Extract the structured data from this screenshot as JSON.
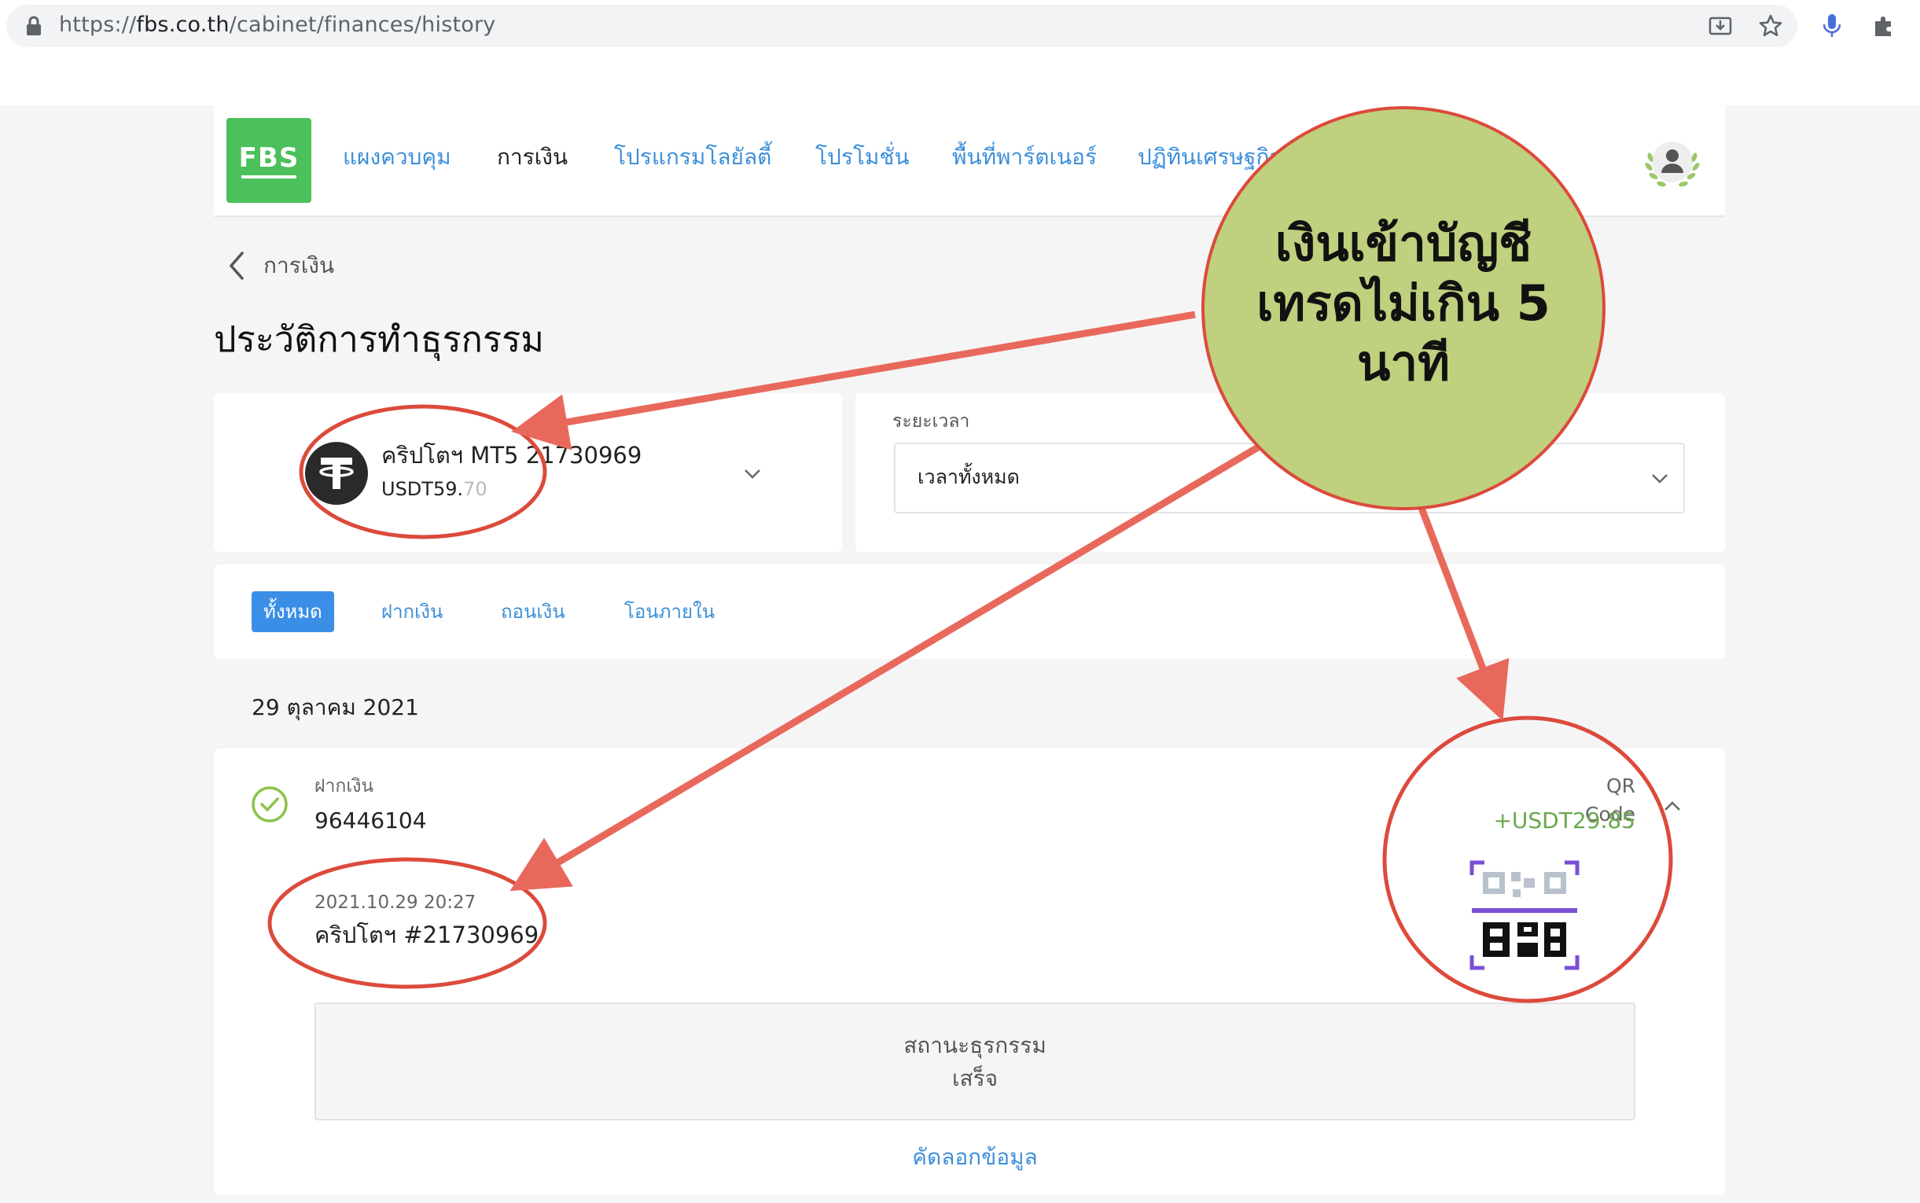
{
  "browser": {
    "url_prefix": "https://",
    "url_domain": "fbs.co.th",
    "url_path": "/cabinet/finances/history",
    "icons": [
      "lock-icon",
      "install-app-icon",
      "bookmark-star-icon",
      "microphone-icon",
      "extensions-icon"
    ]
  },
  "header": {
    "logo_text": "FBS",
    "nav": [
      {
        "label": "แผงควบคุม",
        "active": false
      },
      {
        "label": "การเงิน",
        "active": true
      },
      {
        "label": "โปรแกรมโลยัลตี้",
        "active": false
      },
      {
        "label": "โปรโมชั่น",
        "active": false
      },
      {
        "label": "พื้นที่พาร์ตเนอร์",
        "active": false
      },
      {
        "label": "ปฏิทินเศรษฐกิจ",
        "active": false
      }
    ],
    "avatar_icon": "user-avatar-laurel-icon"
  },
  "breadcrumb": {
    "label": "การเงิน"
  },
  "page_title": "ประวัติการทำธุรกรรม",
  "account": {
    "name": "คริปโตฯ  MT5  21730969",
    "balance_main": "USDT59.",
    "balance_decimal": "70",
    "icon": "tether-icon"
  },
  "period": {
    "label": "ระยะเวลา",
    "value": "เวลาทั้งหมด"
  },
  "tabs": [
    {
      "label": "ทั้งหมด",
      "active": true
    },
    {
      "label": "ฝากเงิน",
      "active": false
    },
    {
      "label": "ถอนเงิน",
      "active": false
    },
    {
      "label": "โอนภายใน",
      "active": false
    }
  ],
  "date_heading": "29 ตุลาคม 2021",
  "transaction": {
    "type": "ฝากเงิน",
    "id": "96446104",
    "datetime": "2021.10.29 20:27",
    "account": "คริปโตฯ  #21730969",
    "method": "QR Code",
    "amount": "+USDT29.85",
    "status_label": "สถานะธุรกรรม",
    "status_value": "เสร็จ",
    "copy_label": "คัดลอกข้อมูล",
    "status_icon": "check-circle-icon"
  },
  "annotation": {
    "callout_text": "เงินเข้าบัญชี\nเทรดไม่เกิน 5\nนาที",
    "callout_fill": "#bfd07e",
    "stroke_color": "#dc4a3c",
    "arrow_color": "#e8695c"
  },
  "colors": {
    "brand_green": "#4cc05a",
    "link_blue": "#3d8fd9",
    "active_tab": "#3a8ee6",
    "amount_green": "#6aa84f"
  }
}
